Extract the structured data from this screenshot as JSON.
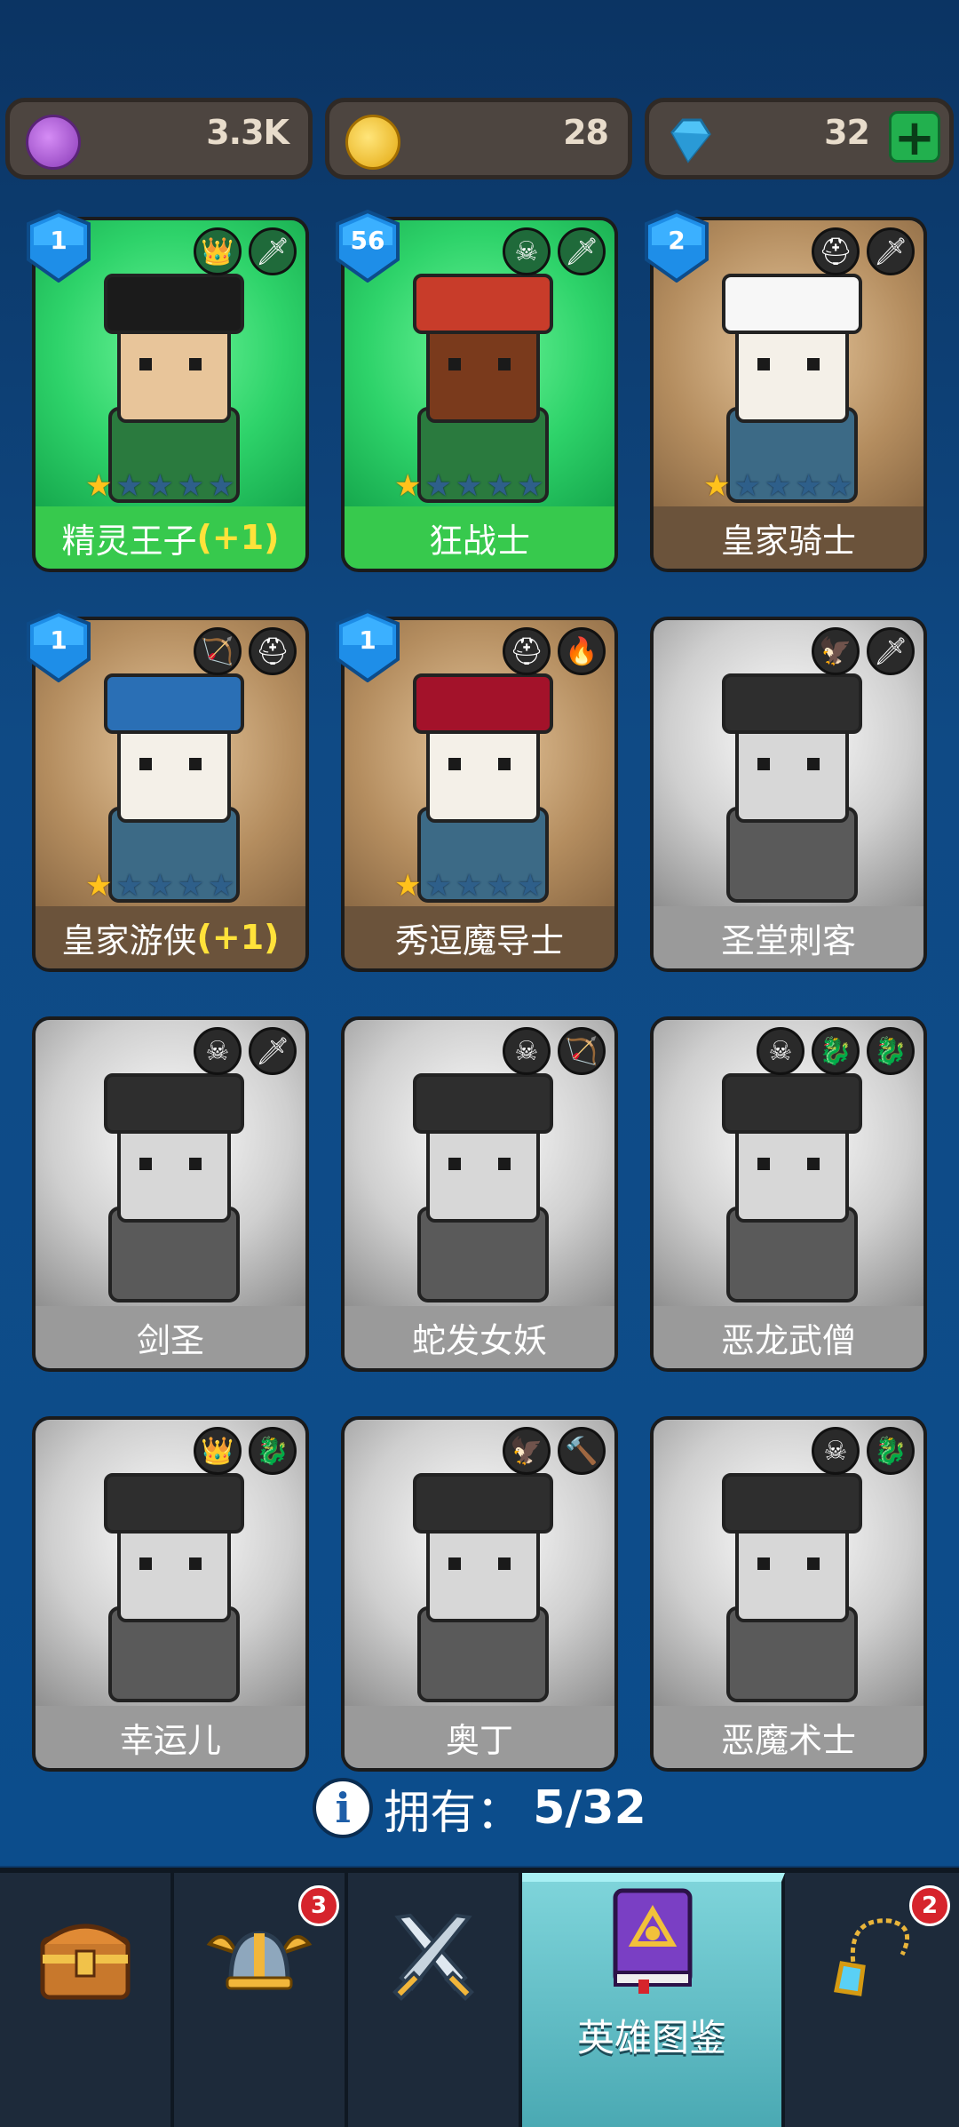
{
  "currencies": [
    {
      "name": "purple-coin",
      "value": "3.3K",
      "color": "#9a4ac2"
    },
    {
      "name": "gold-coin",
      "value": "28",
      "color": "#f3c21f"
    },
    {
      "name": "diamond",
      "value": "32",
      "color": "#4fc3f7"
    }
  ],
  "add_label": "+",
  "cards": [
    {
      "name": "精灵王子",
      "suffix": "(+1)",
      "level": "1",
      "stars": 1,
      "theme": "green"
    },
    {
      "name": "狂战士",
      "suffix": "",
      "level": "56",
      "stars": 1,
      "theme": "green"
    },
    {
      "name": "皇家骑士",
      "suffix": "",
      "level": "2",
      "stars": 1,
      "theme": "brown"
    },
    {
      "name": "皇家游侠",
      "suffix": "(+1)",
      "level": "1",
      "stars": 1,
      "theme": "brown"
    },
    {
      "name": "秀逗魔导士",
      "suffix": "",
      "level": "1",
      "stars": 1,
      "theme": "brown"
    },
    {
      "name": "圣堂刺客",
      "suffix": "",
      "level": "",
      "stars": 0,
      "theme": "gray"
    },
    {
      "name": "剑圣",
      "suffix": "",
      "level": "",
      "stars": 0,
      "theme": "gray"
    },
    {
      "name": "蛇发女妖",
      "suffix": "",
      "level": "",
      "stars": 0,
      "theme": "gray"
    },
    {
      "name": "恶龙武僧",
      "suffix": "",
      "level": "",
      "stars": 0,
      "theme": "gray"
    },
    {
      "name": "幸运儿",
      "suffix": "",
      "level": "",
      "stars": 0,
      "theme": "gray"
    },
    {
      "name": "奥丁",
      "suffix": "",
      "level": "",
      "stars": 0,
      "theme": "gray"
    },
    {
      "name": "恶魔术士",
      "suffix": "",
      "level": "",
      "stars": 0,
      "theme": "gray"
    }
  ],
  "owned": {
    "label": "拥有：",
    "value": "5/32"
  },
  "nav": {
    "items": [
      {
        "name": "treasure-chest",
        "badge": ""
      },
      {
        "name": "viking-helmet",
        "badge": "3"
      },
      {
        "name": "crossed-swords",
        "badge": ""
      },
      {
        "name": "hero-codex",
        "label": "英雄图鉴",
        "badge": ""
      },
      {
        "name": "amulet",
        "badge": "2"
      }
    ]
  }
}
